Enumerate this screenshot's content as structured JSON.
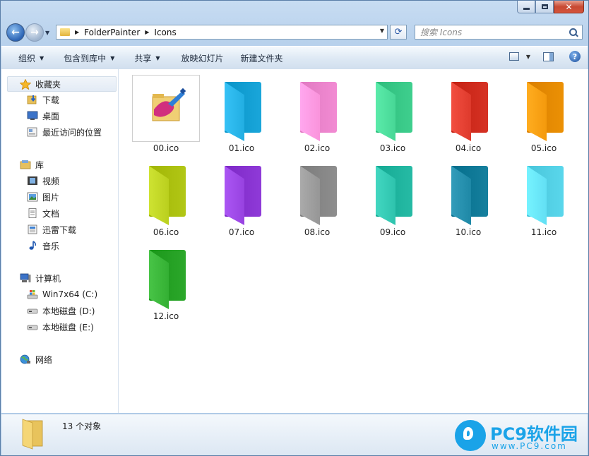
{
  "address": {
    "crumbs": [
      "FolderPainter",
      "Icons"
    ],
    "search_placeholder": "搜索 Icons"
  },
  "toolbar": {
    "organize": "组织",
    "include_in_library": "包含到库中",
    "share": "共享",
    "slideshow": "放映幻灯片",
    "new_folder": "新建文件夹",
    "help": "?"
  },
  "sidebar": {
    "favorites": "收藏夹",
    "downloads": "下载",
    "desktop": "桌面",
    "recent": "最近访问的位置",
    "libraries": "库",
    "videos": "视频",
    "pictures": "图片",
    "documents": "文档",
    "thunder": "迅雷下载",
    "music": "音乐",
    "computer": "计算机",
    "drive_c": "Win7x64 (C:)",
    "drive_d": "本地磁盘 (D:)",
    "drive_e": "本地磁盘 (E:)",
    "network": "网络"
  },
  "files": [
    {
      "name": "00.ico",
      "color": "painter"
    },
    {
      "name": "01.ico",
      "color": "#1aa6da"
    },
    {
      "name": "02.ico",
      "color": "#f28bd3"
    },
    {
      "name": "03.ico",
      "color": "#3fcf8e"
    },
    {
      "name": "04.ico",
      "color": "#d63224"
    },
    {
      "name": "05.ico",
      "color": "#ec9104"
    },
    {
      "name": "06.ico",
      "color": "#b2c716"
    },
    {
      "name": "07.ico",
      "color": "#8f3ad8"
    },
    {
      "name": "08.ico",
      "color": "#8e8e8e"
    },
    {
      "name": "09.ico",
      "color": "#26bba5"
    },
    {
      "name": "10.ico",
      "color": "#16809e"
    },
    {
      "name": "11.ico",
      "color": "#5ad7ec"
    },
    {
      "name": "12.ico",
      "color": "#2ca82b"
    }
  ],
  "status": {
    "count": "13 个对象"
  },
  "watermark": {
    "brand": "PC9软件园",
    "url": "www.PC9.com"
  }
}
